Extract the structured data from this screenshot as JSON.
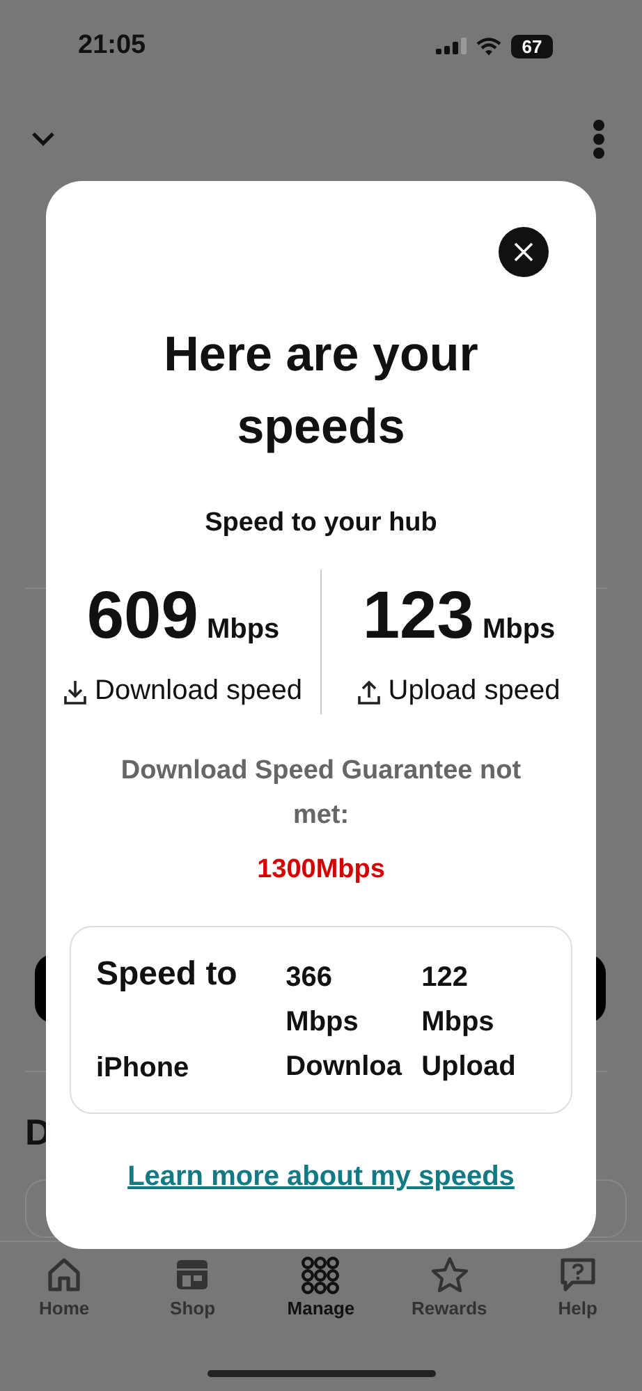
{
  "status_bar": {
    "time": "21:05",
    "battery": "67"
  },
  "background": {
    "headings": [
      "D"
    ]
  },
  "dialog": {
    "title": "Here are your speeds",
    "subtitle": "Speed to your hub",
    "speeds": [
      {
        "kind": "download",
        "value": "609",
        "unit": "Mbps",
        "label": "Download speed"
      },
      {
        "kind": "upload",
        "value": "123",
        "unit": "Mbps",
        "label": "Upload speed"
      }
    ],
    "guarantee": "Download Speed Guarantee not met:",
    "guarantee_value": "1300Mbps",
    "device": {
      "title": "Speed to",
      "name": "iPhone",
      "columns": [
        {
          "value": "366",
          "unit": "Mbps",
          "label": "Downloa"
        },
        {
          "value": "122",
          "unit": "Mbps",
          "label": "Upload"
        }
      ]
    },
    "link": "Learn more about my speeds"
  },
  "tab_bar": [
    {
      "label": "Home",
      "selected": false
    },
    {
      "label": "Shop",
      "selected": false
    },
    {
      "label": "Manage",
      "selected": true
    },
    {
      "label": "Rewards",
      "selected": false
    },
    {
      "label": "Help",
      "selected": false
    }
  ]
}
